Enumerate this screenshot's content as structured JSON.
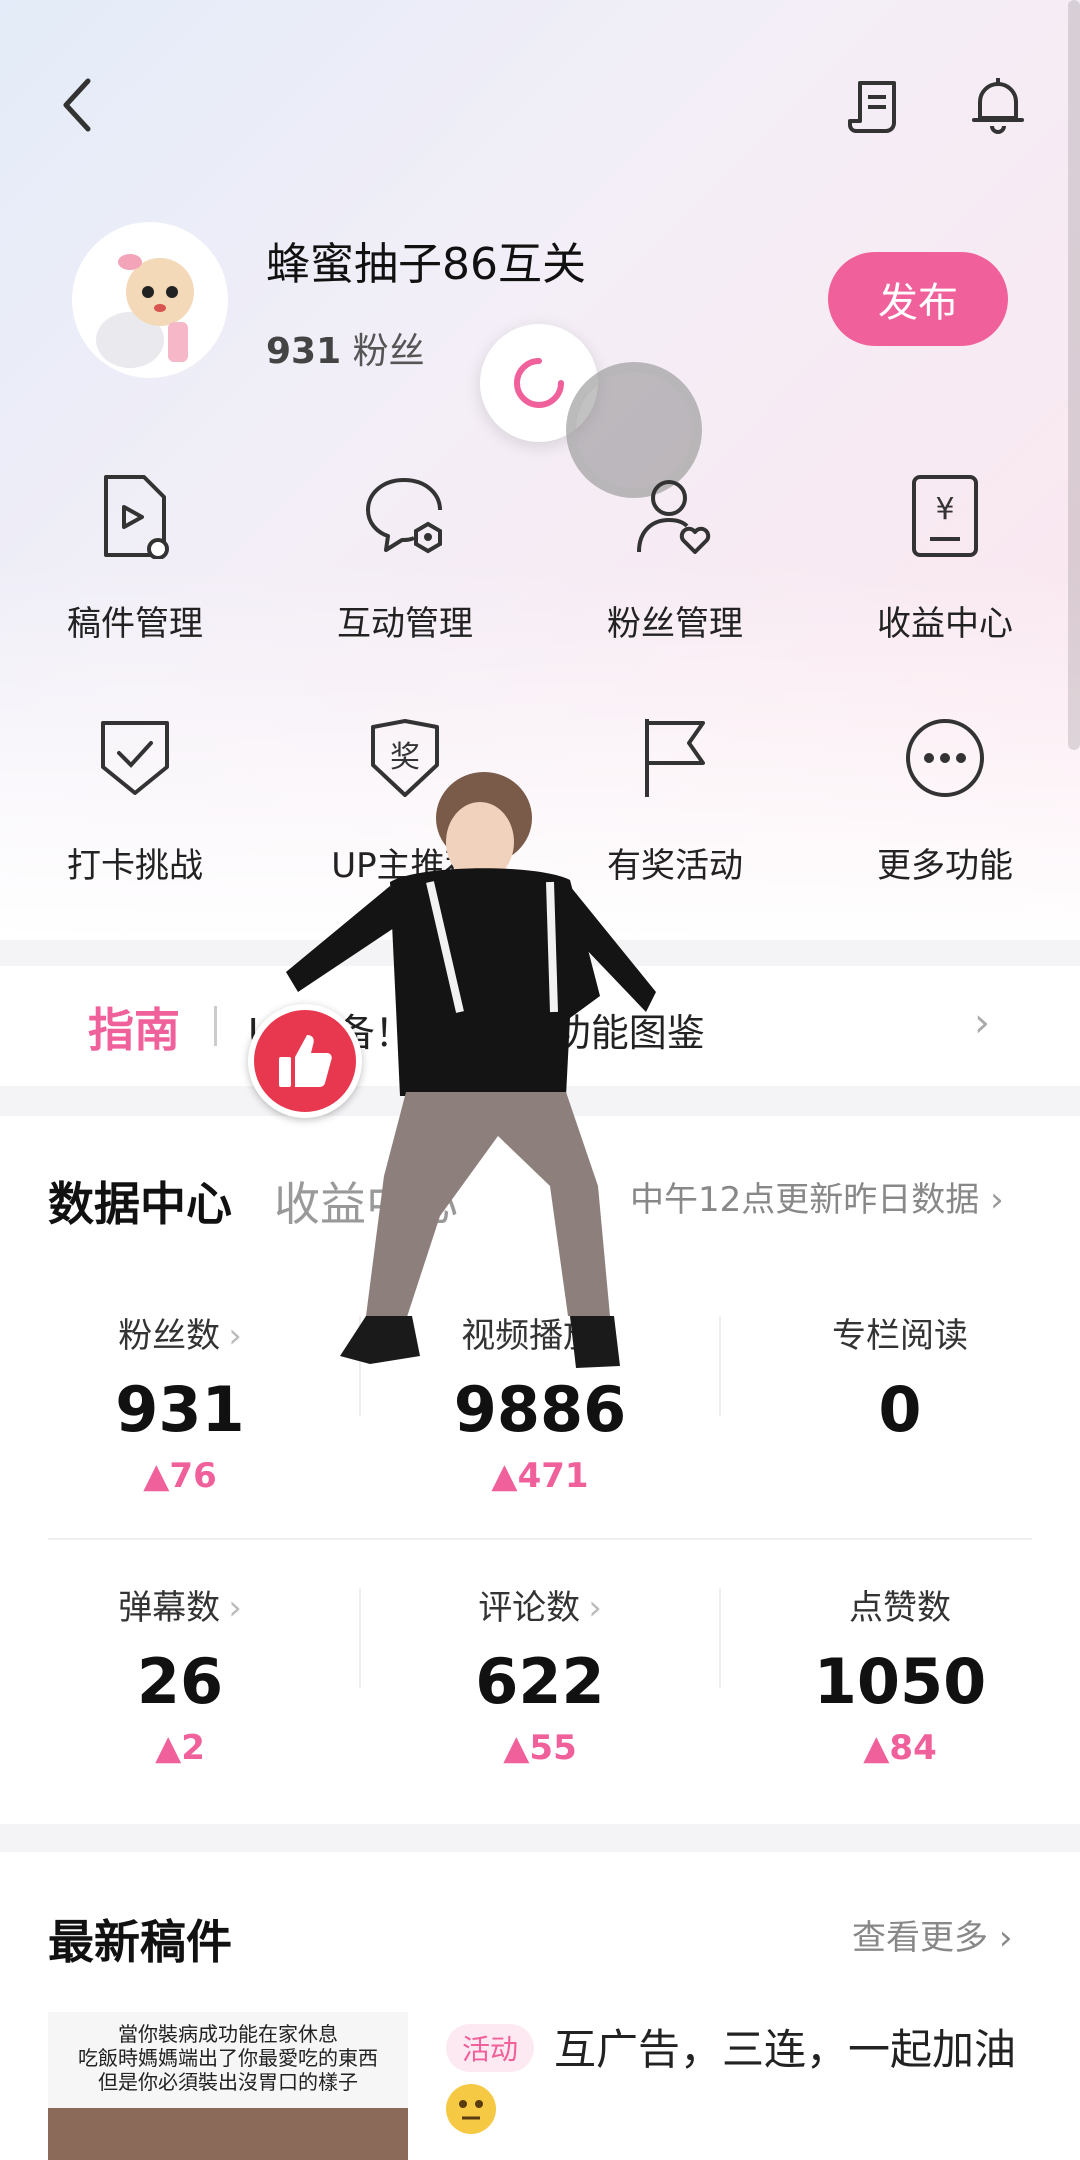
{
  "header": {
    "back_icon": "chevron-left-icon",
    "guide_icon": "document-list-icon",
    "bell_icon": "bell-icon"
  },
  "profile": {
    "name": "蜂蜜抽子86互关",
    "fans_count": "931",
    "fans_label": "粉丝",
    "publish_label": "发布"
  },
  "functions": [
    {
      "label": "稿件管理",
      "icon": "video-file-icon"
    },
    {
      "label": "互动管理",
      "icon": "chat-gear-icon"
    },
    {
      "label": "粉丝管理",
      "icon": "user-heart-icon"
    },
    {
      "label": "收益中心",
      "icon": "yen-card-icon"
    },
    {
      "label": "打卡挑战",
      "icon": "shield-check-icon"
    },
    {
      "label": "UP主推荐",
      "icon": "award-badge-icon"
    },
    {
      "label": "有奖活动",
      "icon": "flag-icon"
    },
    {
      "label": "更多功能",
      "icon": "more-dots-icon"
    }
  ],
  "guide": {
    "tag": "指南",
    "text": "UP必备！B站创作功能图鉴"
  },
  "data_center": {
    "tab_active": "数据中心",
    "tab_inactive": "收益中心",
    "update_note": "中午12点更新昨日数据",
    "stats": [
      {
        "label": "粉丝数",
        "value": "931",
        "delta": "76"
      },
      {
        "label": "视频播放",
        "value": "9886",
        "delta": "471"
      },
      {
        "label": "专栏阅读",
        "value": "0",
        "delta": ""
      },
      {
        "label": "弹幕数",
        "value": "26",
        "delta": "2"
      },
      {
        "label": "评论数",
        "value": "622",
        "delta": "55"
      },
      {
        "label": "点赞数",
        "value": "1050",
        "delta": "84"
      }
    ]
  },
  "latest": {
    "title": "最新稿件",
    "more": "查看更多",
    "post": {
      "badge": "活动",
      "title": "互广告，三连，一起加油",
      "thumb_caption": [
        "當你裝病成功能在家休息",
        "吃飯時媽媽端出了你最愛吃的東西",
        "但是你必須裝出沒胃口的樣子"
      ]
    }
  },
  "colors": {
    "accent": "#f0609a",
    "like": "#e8384f"
  }
}
